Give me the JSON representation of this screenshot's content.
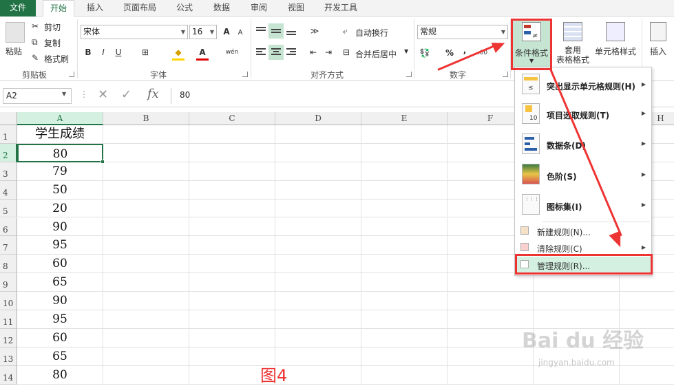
{
  "tabs": [
    "文件",
    "开始",
    "插入",
    "页面布局",
    "公式",
    "数据",
    "审阅",
    "视图",
    "开发工具"
  ],
  "clipboard": {
    "paste": "粘贴",
    "cut": "剪切",
    "copy": "复制",
    "painter": "格式刷",
    "label": "剪贴板"
  },
  "font": {
    "name": "宋体",
    "size": "16",
    "bold": "B",
    "italic": "I",
    "underline": "U",
    "grow": "A",
    "shrink": "A",
    "phonetic": "wén",
    "label": "字体"
  },
  "alignment": {
    "wrap": "自动换行",
    "merge": "合并后居中",
    "label": "对齐方式"
  },
  "number": {
    "format": "常规",
    "percent": "%",
    "comma": ",",
    "label": "数字"
  },
  "styles": {
    "conditional": "条件格式",
    "table": "套用\n表格格式",
    "cell": "单元格样式"
  },
  "cells": {
    "insert": "插入"
  },
  "formula": {
    "namebox": "A2",
    "value": "80",
    "fx": "fx"
  },
  "columns": [
    "A",
    "B",
    "C",
    "D",
    "E",
    "F",
    "H"
  ],
  "rows": [
    "1",
    "2",
    "3",
    "4",
    "5",
    "6",
    "7",
    "8",
    "9",
    "10",
    "11",
    "12",
    "13",
    "14"
  ],
  "colA": [
    "学生成绩",
    "80",
    "79",
    "50",
    "20",
    "90",
    "95",
    "60",
    "65",
    "90",
    "95",
    "60",
    "65",
    "80"
  ],
  "menu": {
    "items": [
      {
        "label": "突出显示单元格规则(H)",
        "sub": true
      },
      {
        "label": "项目选取规则(T)",
        "sub": true
      },
      {
        "label": "数据条(D)",
        "sub": true
      },
      {
        "label": "色阶(S)",
        "sub": true
      },
      {
        "label": "图标集(I)",
        "sub": true
      }
    ],
    "small": [
      {
        "label": "新建规则(N)..."
      },
      {
        "label": "清除规则(C)"
      },
      {
        "label": "管理规则(R)..."
      }
    ],
    "icon10": "10"
  },
  "annotation": "图4",
  "watermark": "Bai du 经验",
  "watermark_url": "jingyan.baidu.com",
  "colors": {
    "accent": "#217346",
    "highlight": "#e33333"
  }
}
